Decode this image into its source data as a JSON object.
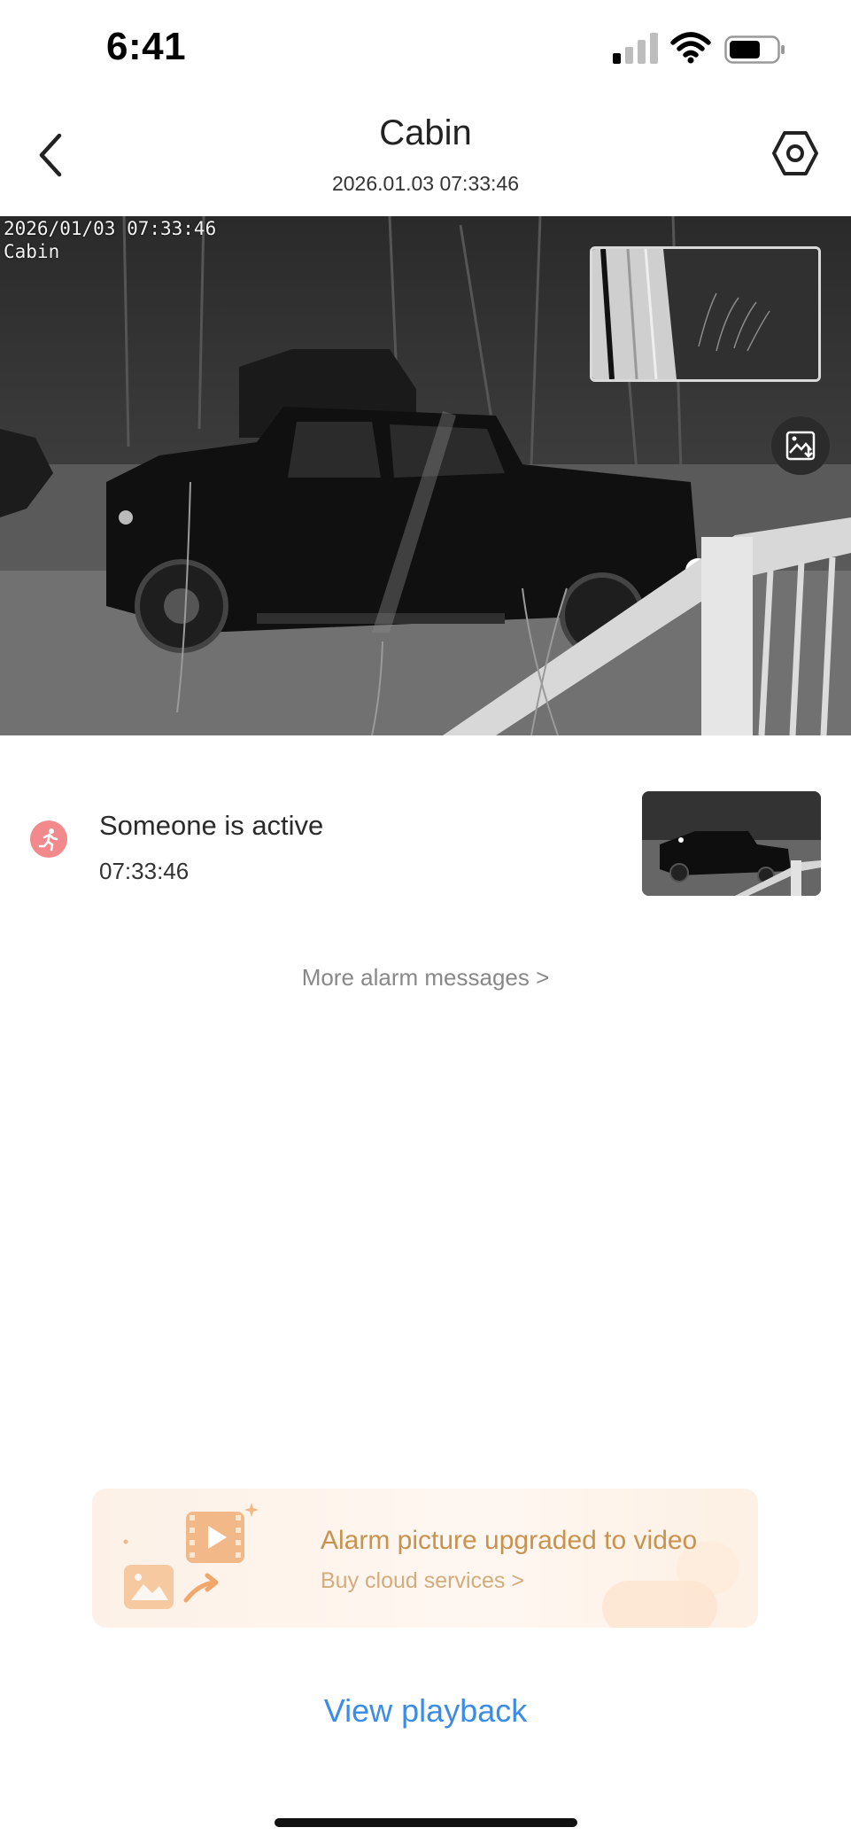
{
  "status_bar": {
    "time": "6:41"
  },
  "header": {
    "title": "Cabin",
    "subtitle": "2026.01.03 07:33:46"
  },
  "camera": {
    "osd_timestamp": "2026/01/03 07:33:46",
    "osd_camera_name": "Cabin"
  },
  "alarm": {
    "title": "Someone is active",
    "time": "07:33:46",
    "icon": "running-person-icon",
    "icon_color": "#f2898c"
  },
  "more_alarms_label": "More alarm messages >",
  "banner": {
    "title": "Alarm picture upgraded to video",
    "subtitle": "Buy cloud services >"
  },
  "view_playback_label": "View playback",
  "colors": {
    "accent_blue": "#3b8ce6",
    "banner_text": "#c8924f"
  }
}
